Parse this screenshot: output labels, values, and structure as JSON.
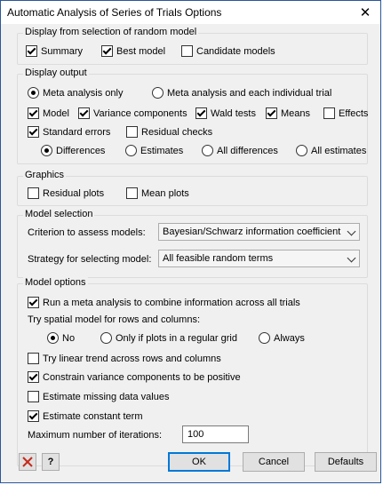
{
  "window": {
    "title": "Automatic Analysis of Series of Trials Options",
    "close_glyph": "✕"
  },
  "display_random": {
    "title": "Display from selection of random model",
    "summary": "Summary",
    "best_model": "Best model",
    "candidate_models": "Candidate models",
    "summary_checked": true,
    "best_model_checked": true,
    "candidate_models_checked": false
  },
  "display_output": {
    "title": "Display output",
    "radio_meta_only": "Meta analysis only",
    "radio_meta_each": "Meta analysis and each individual trial",
    "model": "Model",
    "variance_components": "Variance components",
    "wald_tests": "Wald tests",
    "means": "Means",
    "effects": "Effects",
    "standard_errors": "Standard errors",
    "residual_checks": "Residual checks",
    "differences": "Differences",
    "estimates": "Estimates",
    "all_differences": "All differences",
    "all_estimates": "All estimates"
  },
  "graphics": {
    "title": "Graphics",
    "residual_plots": "Residual plots",
    "mean_plots": "Mean plots"
  },
  "model_selection": {
    "title": "Model selection",
    "criterion_label": "Criterion to assess models:",
    "criterion_value": "Bayesian/Schwarz information coefficient",
    "strategy_label": "Strategy for selecting model:",
    "strategy_value": "All feasible random terms"
  },
  "model_options": {
    "title": "Model options",
    "run_meta": "Run a meta analysis to combine information across all trials",
    "spatial_label": "Try spatial model for rows and columns:",
    "spatial_no": "No",
    "spatial_regular": "Only if plots in a regular grid",
    "spatial_always": "Always",
    "linear_trend": "Try linear trend across rows and columns",
    "constrain_variance": "Constrain variance components to be positive",
    "estimate_missing": "Estimate missing data values",
    "estimate_constant": "Estimate constant term",
    "max_iter_label": "Maximum number of iterations:",
    "max_iter_value": "100"
  },
  "footer": {
    "ok": "OK",
    "cancel": "Cancel",
    "defaults": "Defaults",
    "help_glyph": "?"
  },
  "colors": {
    "accent": "#0078d7",
    "cancel_icon": "#c42b1c",
    "window_border": "#2b579a"
  }
}
